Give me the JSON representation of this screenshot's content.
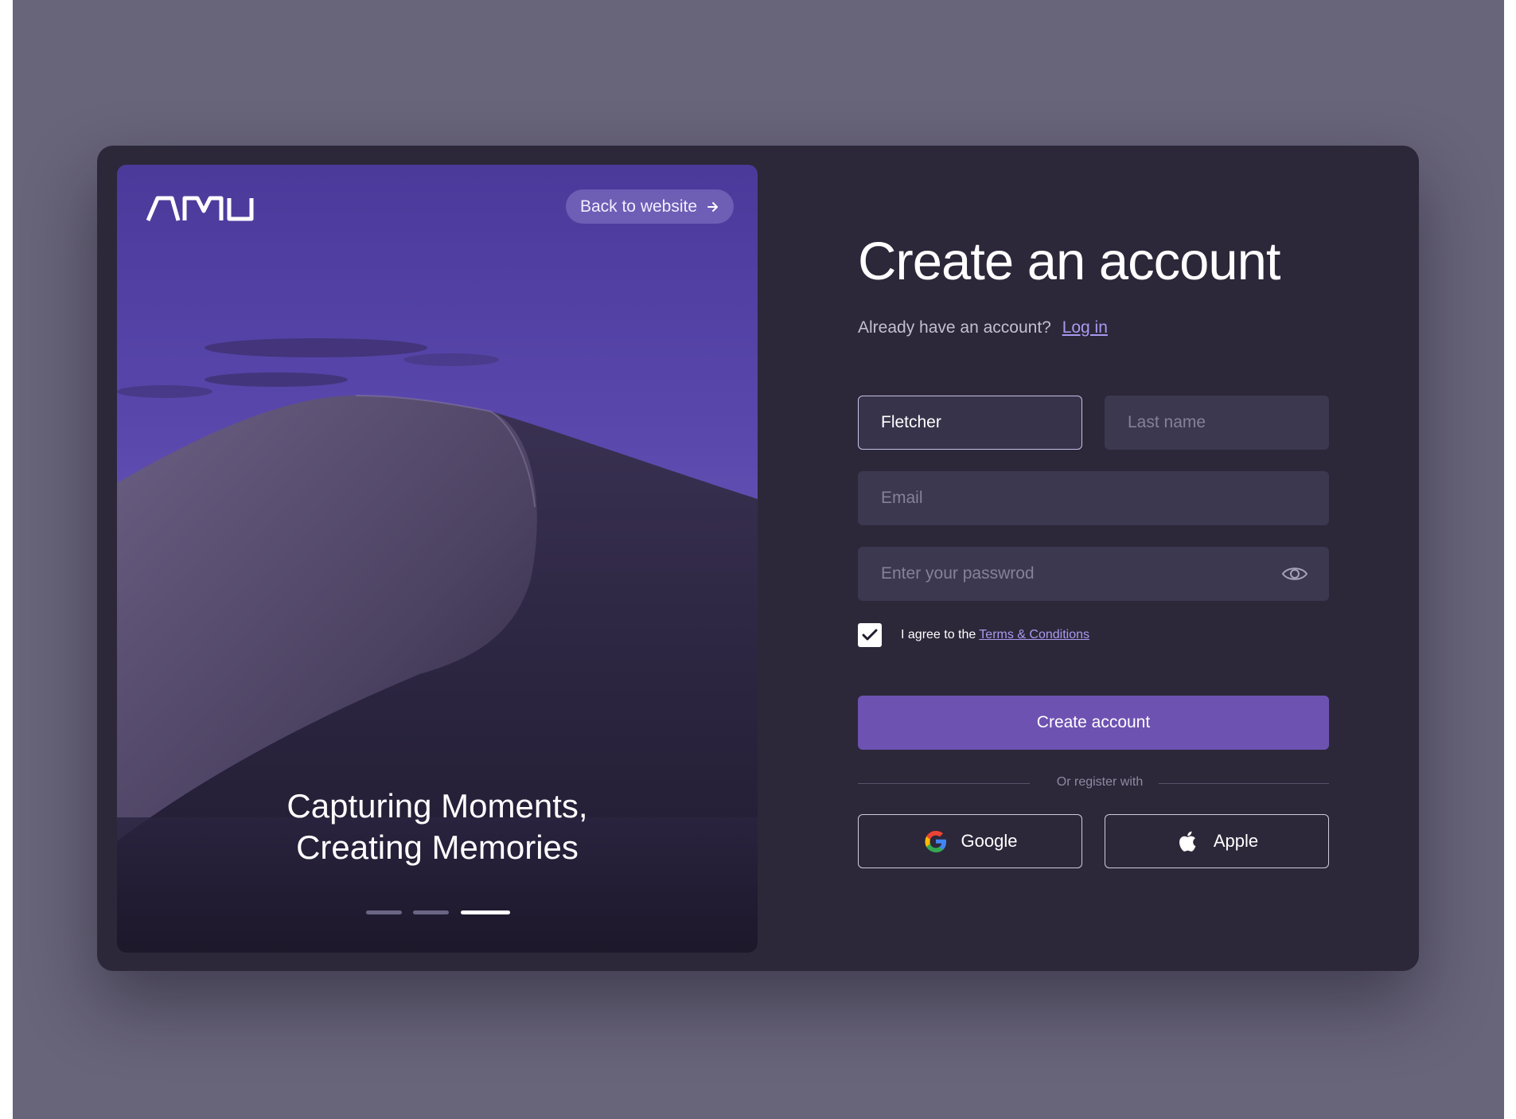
{
  "brand": {
    "logo_text": "AMU"
  },
  "hero": {
    "back_label": "Back to website",
    "tagline_line1": "Capturing Moments,",
    "tagline_line2": "Creating Memories",
    "slides": {
      "count": 3,
      "active_index": 2
    }
  },
  "form": {
    "title": "Create an account",
    "login_prompt": "Already have an account?",
    "login_link": "Log in",
    "first_name_value": "Fletcher",
    "last_name_placeholder": "Last name",
    "email_placeholder": "Email",
    "password_placeholder": "Enter your passwrod",
    "agree_text": "I agree to the",
    "terms_link": "Terms & Conditions",
    "agree_checked": true,
    "submit_label": "Create account",
    "divider_text": "Or register with",
    "google_label": "Google",
    "apple_label": "Apple"
  },
  "colors": {
    "card_bg": "#2c2839",
    "field_bg": "#3c3850",
    "primary": "#6e52b2",
    "link": "#a99aef"
  }
}
